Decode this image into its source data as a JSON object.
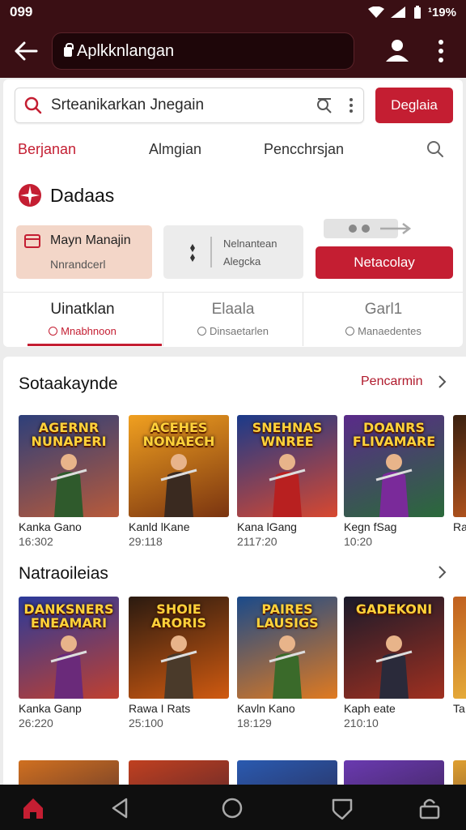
{
  "status": {
    "time": "099",
    "battery": "¹19%"
  },
  "browser": {
    "url": "Aplkknlangan"
  },
  "search": {
    "placeholder": "Srteanikarkan Jnegain",
    "button": "Deglaia"
  },
  "nav_tabs": [
    "Berjanan",
    "Almgian",
    "Pencchrsjan"
  ],
  "brand": {
    "name": "Dadaas"
  },
  "tiles": {
    "tile1": {
      "title": "Mayn Manajin",
      "subtitle": "Nnrandcerl"
    },
    "tile2": {
      "line1": "Nelnantean",
      "line2": "Alegcka"
    },
    "button": "Netacolay"
  },
  "sub_tabs": [
    {
      "label": "Uinatklan",
      "sub": "Mnabhnoon"
    },
    {
      "label": "Elaala",
      "sub": "Dinsaetarlen"
    },
    {
      "label": "Garl1",
      "sub": "Manaedentes"
    }
  ],
  "section1": {
    "title": "Sotaakaynde",
    "link": "Pencarmin",
    "games": [
      {
        "art": "AGERNR\nNUNAPERI",
        "name": "Kanka Gano",
        "meta": "16:302",
        "c1": "#2d3f7a",
        "c2": "#b85a3a",
        "fig": "#2f5a2c"
      },
      {
        "art": "ACEHES\nNONAECH",
        "name": "Kanld lKane",
        "meta": "29:118",
        "c1": "#f0a020",
        "c2": "#7a3410",
        "fig": "#3a2a20"
      },
      {
        "art": "SNEHNAS\nWNREE",
        "name": "Kana lGang",
        "meta": "2117:20",
        "c1": "#1a3a8a",
        "c2": "#d84830",
        "fig": "#b82020"
      },
      {
        "art": "DOANRS\nFLIVAMARE",
        "name": "Kegn fSag",
        "meta": "10:20",
        "c1": "#5a2a8a",
        "c2": "#2a6a3a",
        "fig": "#7a2a9a"
      },
      {
        "art": "",
        "name": "Ra",
        "meta": "",
        "c1": "#3a2010",
        "c2": "#d06020",
        "fig": "#2a1a10"
      }
    ]
  },
  "section2": {
    "title": "Natraoileias",
    "games": [
      {
        "art": "DANKSNERS\nENEAMARI",
        "name": "Kanka Ganp",
        "meta": "26:220",
        "c1": "#2a3a9a",
        "c2": "#c04030",
        "fig": "#6a2a7a"
      },
      {
        "art": "SHOIE\nARORIS",
        "name": "Rawa I Rats",
        "meta": "25:100",
        "c1": "#2a1a10",
        "c2": "#d05a10",
        "fig": "#4a3a2a"
      },
      {
        "art": "PAIRES\nLAUSIGS",
        "name": "Kavln Kano",
        "meta": "18:129",
        "c1": "#1a4a8a",
        "c2": "#e07a20",
        "fig": "#3a6a2a"
      },
      {
        "art": "GADEKONI",
        "name": "Kaph eate",
        "meta": "210:10",
        "c1": "#1a1a2a",
        "c2": "#a03020",
        "fig": "#2a2a3a"
      },
      {
        "art": "",
        "name": "Ta",
        "meta": "",
        "c1": "#c06020",
        "c2": "#f0c040",
        "fig": "#402010"
      }
    ]
  },
  "section3_colors": [
    "#d07020",
    "#c04020",
    "#2a5ab0",
    "#6a3ab0",
    "#e0a030"
  ],
  "colors": {
    "accent": "#c41e32",
    "header": "#3a0f14"
  }
}
